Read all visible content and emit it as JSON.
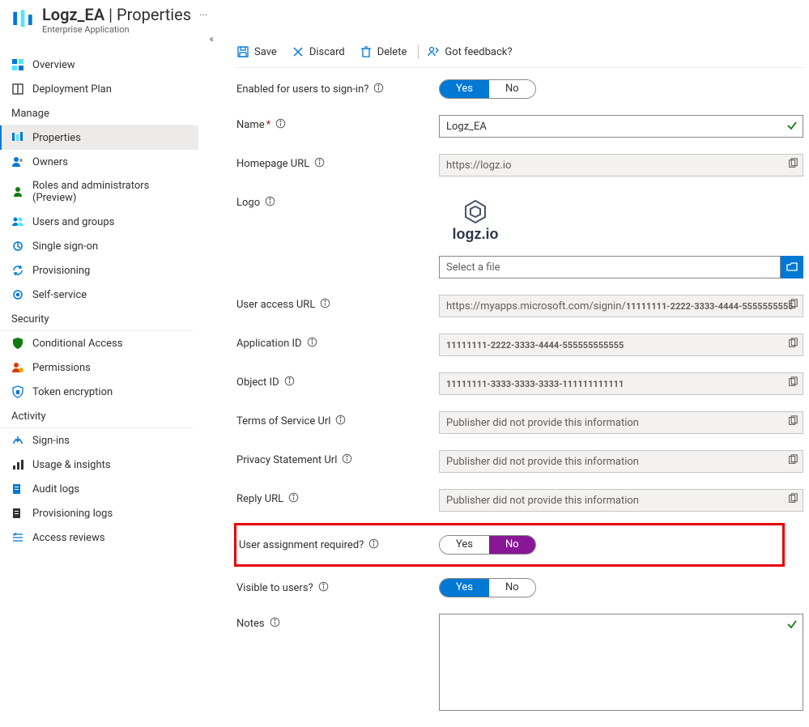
{
  "header": {
    "app": "Logz_EA",
    "page": "Properties",
    "subtitle": "Enterprise Application"
  },
  "toolbar": {
    "save": "Save",
    "discard": "Discard",
    "delete": "Delete",
    "feedback": "Got feedback?"
  },
  "sidebar": {
    "top": [
      {
        "label": "Overview"
      },
      {
        "label": "Deployment Plan"
      }
    ],
    "groups": [
      {
        "title": "Manage",
        "items": [
          {
            "label": "Properties",
            "active": true
          },
          {
            "label": "Owners"
          },
          {
            "label": "Roles and administrators (Preview)"
          },
          {
            "label": "Users and groups"
          },
          {
            "label": "Single sign-on"
          },
          {
            "label": "Provisioning"
          },
          {
            "label": "Self-service"
          }
        ]
      },
      {
        "title": "Security",
        "items": [
          {
            "label": "Conditional Access"
          },
          {
            "label": "Permissions"
          },
          {
            "label": "Token encryption"
          }
        ]
      },
      {
        "title": "Activity",
        "items": [
          {
            "label": "Sign-ins"
          },
          {
            "label": "Usage & insights"
          },
          {
            "label": "Audit logs"
          },
          {
            "label": "Provisioning logs"
          },
          {
            "label": "Access reviews"
          }
        ]
      }
    ]
  },
  "form": {
    "enabled_label": "Enabled for users to sign-in?",
    "name_label": "Name",
    "name_value": "Logz_EA",
    "homepage_label": "Homepage URL",
    "homepage_value": "https://logz.io",
    "logo_label": "Logo",
    "logo_text": "logz.io",
    "file_placeholder": "Select a file",
    "access_url_label": "User access URL",
    "access_url_prefix": "https://myapps.microsoft.com/signin/ ",
    "access_url_suffix": "11111111-2222-3333-4444-5555555555",
    "app_id_label": "Application ID",
    "app_id_value": "11111111-2222-3333-4444-555555555555",
    "obj_id_label": "Object ID",
    "obj_id_value": "11111111-3333-3333-3333-111111111111",
    "tos_label": "Terms of Service Url",
    "privacy_label": "Privacy Statement Url",
    "reply_label": "Reply URL",
    "publisher_na": "Publisher did not provide this information",
    "assign_label": "User assignment required?",
    "visible_label": "Visible to users?",
    "notes_label": "Notes",
    "yes": "Yes",
    "no": "No"
  }
}
